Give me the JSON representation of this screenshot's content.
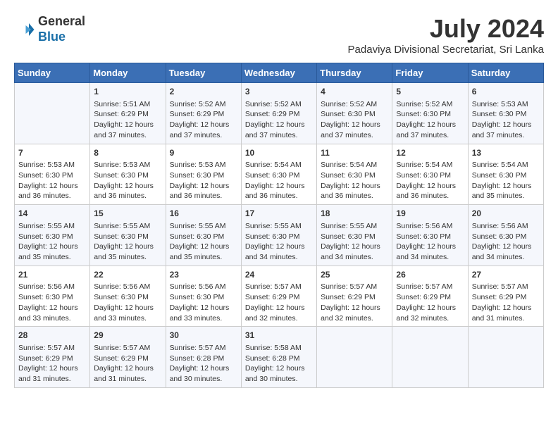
{
  "header": {
    "logo_line1": "General",
    "logo_line2": "Blue",
    "title": "July 2024",
    "subtitle": "Padaviya Divisional Secretariat, Sri Lanka"
  },
  "days_of_week": [
    "Sunday",
    "Monday",
    "Tuesday",
    "Wednesday",
    "Thursday",
    "Friday",
    "Saturday"
  ],
  "weeks": [
    [
      {
        "num": "",
        "info": ""
      },
      {
        "num": "1",
        "info": "Sunrise: 5:51 AM\nSunset: 6:29 PM\nDaylight: 12 hours\nand 37 minutes."
      },
      {
        "num": "2",
        "info": "Sunrise: 5:52 AM\nSunset: 6:29 PM\nDaylight: 12 hours\nand 37 minutes."
      },
      {
        "num": "3",
        "info": "Sunrise: 5:52 AM\nSunset: 6:29 PM\nDaylight: 12 hours\nand 37 minutes."
      },
      {
        "num": "4",
        "info": "Sunrise: 5:52 AM\nSunset: 6:30 PM\nDaylight: 12 hours\nand 37 minutes."
      },
      {
        "num": "5",
        "info": "Sunrise: 5:52 AM\nSunset: 6:30 PM\nDaylight: 12 hours\nand 37 minutes."
      },
      {
        "num": "6",
        "info": "Sunrise: 5:53 AM\nSunset: 6:30 PM\nDaylight: 12 hours\nand 37 minutes."
      }
    ],
    [
      {
        "num": "7",
        "info": "Sunrise: 5:53 AM\nSunset: 6:30 PM\nDaylight: 12 hours\nand 36 minutes."
      },
      {
        "num": "8",
        "info": "Sunrise: 5:53 AM\nSunset: 6:30 PM\nDaylight: 12 hours\nand 36 minutes."
      },
      {
        "num": "9",
        "info": "Sunrise: 5:53 AM\nSunset: 6:30 PM\nDaylight: 12 hours\nand 36 minutes."
      },
      {
        "num": "10",
        "info": "Sunrise: 5:54 AM\nSunset: 6:30 PM\nDaylight: 12 hours\nand 36 minutes."
      },
      {
        "num": "11",
        "info": "Sunrise: 5:54 AM\nSunset: 6:30 PM\nDaylight: 12 hours\nand 36 minutes."
      },
      {
        "num": "12",
        "info": "Sunrise: 5:54 AM\nSunset: 6:30 PM\nDaylight: 12 hours\nand 36 minutes."
      },
      {
        "num": "13",
        "info": "Sunrise: 5:54 AM\nSunset: 6:30 PM\nDaylight: 12 hours\nand 35 minutes."
      }
    ],
    [
      {
        "num": "14",
        "info": "Sunrise: 5:55 AM\nSunset: 6:30 PM\nDaylight: 12 hours\nand 35 minutes."
      },
      {
        "num": "15",
        "info": "Sunrise: 5:55 AM\nSunset: 6:30 PM\nDaylight: 12 hours\nand 35 minutes."
      },
      {
        "num": "16",
        "info": "Sunrise: 5:55 AM\nSunset: 6:30 PM\nDaylight: 12 hours\nand 35 minutes."
      },
      {
        "num": "17",
        "info": "Sunrise: 5:55 AM\nSunset: 6:30 PM\nDaylight: 12 hours\nand 34 minutes."
      },
      {
        "num": "18",
        "info": "Sunrise: 5:55 AM\nSunset: 6:30 PM\nDaylight: 12 hours\nand 34 minutes."
      },
      {
        "num": "19",
        "info": "Sunrise: 5:56 AM\nSunset: 6:30 PM\nDaylight: 12 hours\nand 34 minutes."
      },
      {
        "num": "20",
        "info": "Sunrise: 5:56 AM\nSunset: 6:30 PM\nDaylight: 12 hours\nand 34 minutes."
      }
    ],
    [
      {
        "num": "21",
        "info": "Sunrise: 5:56 AM\nSunset: 6:30 PM\nDaylight: 12 hours\nand 33 minutes."
      },
      {
        "num": "22",
        "info": "Sunrise: 5:56 AM\nSunset: 6:30 PM\nDaylight: 12 hours\nand 33 minutes."
      },
      {
        "num": "23",
        "info": "Sunrise: 5:56 AM\nSunset: 6:30 PM\nDaylight: 12 hours\nand 33 minutes."
      },
      {
        "num": "24",
        "info": "Sunrise: 5:57 AM\nSunset: 6:29 PM\nDaylight: 12 hours\nand 32 minutes."
      },
      {
        "num": "25",
        "info": "Sunrise: 5:57 AM\nSunset: 6:29 PM\nDaylight: 12 hours\nand 32 minutes."
      },
      {
        "num": "26",
        "info": "Sunrise: 5:57 AM\nSunset: 6:29 PM\nDaylight: 12 hours\nand 32 minutes."
      },
      {
        "num": "27",
        "info": "Sunrise: 5:57 AM\nSunset: 6:29 PM\nDaylight: 12 hours\nand 31 minutes."
      }
    ],
    [
      {
        "num": "28",
        "info": "Sunrise: 5:57 AM\nSunset: 6:29 PM\nDaylight: 12 hours\nand 31 minutes."
      },
      {
        "num": "29",
        "info": "Sunrise: 5:57 AM\nSunset: 6:29 PM\nDaylight: 12 hours\nand 31 minutes."
      },
      {
        "num": "30",
        "info": "Sunrise: 5:57 AM\nSunset: 6:28 PM\nDaylight: 12 hours\nand 30 minutes."
      },
      {
        "num": "31",
        "info": "Sunrise: 5:58 AM\nSunset: 6:28 PM\nDaylight: 12 hours\nand 30 minutes."
      },
      {
        "num": "",
        "info": ""
      },
      {
        "num": "",
        "info": ""
      },
      {
        "num": "",
        "info": ""
      }
    ]
  ]
}
